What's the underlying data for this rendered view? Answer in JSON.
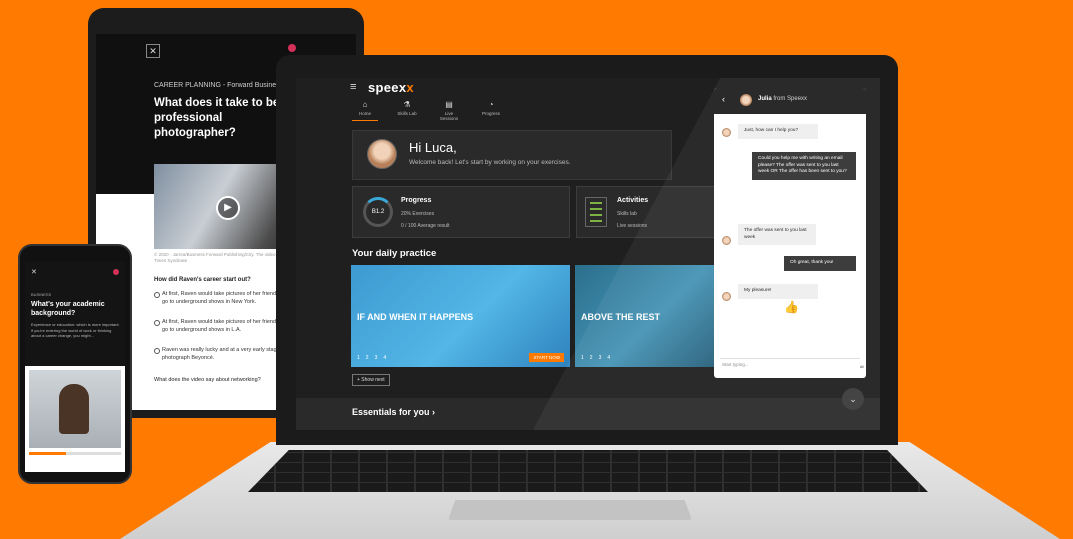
{
  "colors": {
    "background": "#ff7a00",
    "accent": "#ff7a00",
    "dark": "#1f1f1f",
    "progress_ring": "#3aa9d8"
  },
  "tablet": {
    "category": "CAREER PLANNING - Forward Business Review",
    "title": "What does it take to be a professional photographer?",
    "caption": "© 2020 · Jarrea/Business Forward Publishing/City. The video footage belongs to New York Times Syndicate",
    "question": "How did Raven's career start out?",
    "options": [
      "At first, Raven would take pictures of her friends and then she started to go to underground shows in New York.",
      "At first, Raven would take pictures of her friends and then she started to go to underground shows in L.A.",
      "Raven was really lucky and at a very early stage of her career was hired to photograph Beyoncé."
    ],
    "question2": "What does the video say about networking?"
  },
  "phone": {
    "category": "BUSINESS",
    "title": "What's your academic background?",
    "description": "Experience or education: which is more important if you're entering the world of work or thinking about a career change, you might..."
  },
  "app": {
    "logo_main": "speex",
    "logo_accent": "x",
    "nav": [
      {
        "label": "Home",
        "icon": "home-icon",
        "glyph": "⌂"
      },
      {
        "label": "Skills Lab",
        "icon": "lab-icon",
        "glyph": "⚗"
      },
      {
        "label": "Live Sessions",
        "icon": "calendar-icon",
        "glyph": "▤"
      },
      {
        "label": "Progress",
        "icon": "progress-icon",
        "glyph": "◔"
      }
    ],
    "greeting": "Hi Luca,",
    "welcome": "Welcome back! Let's start by working on your exercises.",
    "progress": {
      "title": "Progress",
      "level": "B1.2",
      "exercises": "20% Exercises",
      "average": "0 / 100 Average result"
    },
    "activities": {
      "title": "Activities",
      "line1": "Skills lab",
      "line2": "Live sessions"
    },
    "daily_title": "Your daily practice",
    "tiles": [
      {
        "title": "IF AND WHEN IT HAPPENS",
        "nums": [
          "1",
          "2",
          "3",
          "4"
        ],
        "button": "START NOW"
      },
      {
        "title": "ABOVE THE REST",
        "nums": [
          "1",
          "2",
          "3",
          "4"
        ]
      }
    ],
    "show_next": "+ Show next",
    "essentials": "Essentials for you ›",
    "fab_icon": "⌄"
  },
  "chat": {
    "name": "Julia",
    "from": "from Speexx",
    "messages": [
      {
        "dir": "in",
        "text": "Just, how can I help you?"
      },
      {
        "dir": "out",
        "text": "Could you help me with writing an email please? The offer was sent to you last week OR The offer has been sent to you?"
      },
      {
        "dir": "in",
        "text": "The offer was sent to you last week"
      },
      {
        "dir": "out",
        "text": "Oh great, thank you!"
      },
      {
        "dir": "in",
        "text": "My pleasure!"
      }
    ],
    "placeholder": "Start typing..."
  }
}
